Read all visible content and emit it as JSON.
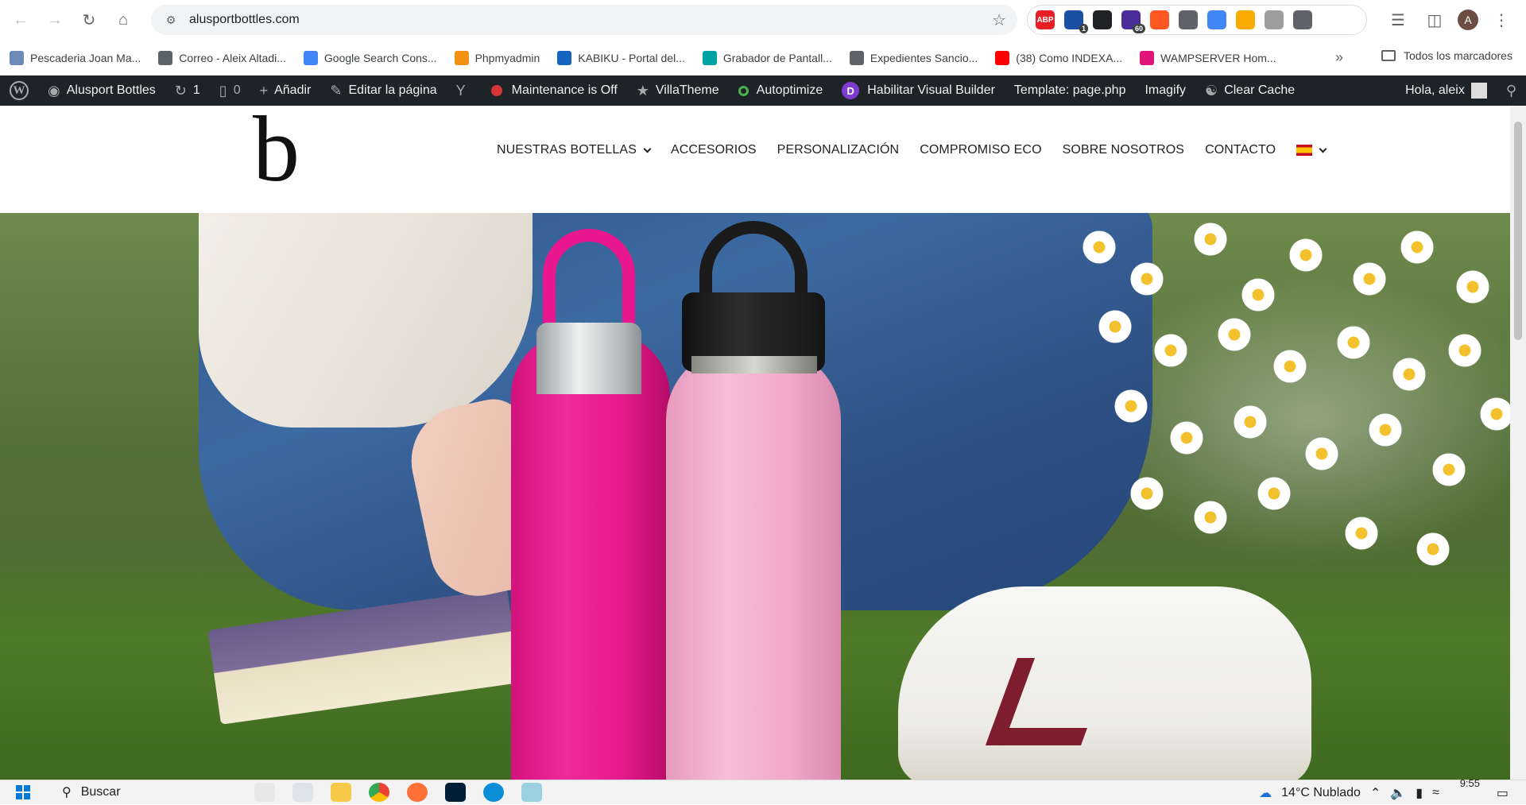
{
  "browser": {
    "url": "alusportbottles.com",
    "extensions": [
      {
        "name": "adblock-extension",
        "label": "ABP",
        "color": "#e81e25"
      },
      {
        "name": "mail-extension",
        "label": "",
        "badge": "1",
        "color": "#1a4fa3"
      },
      {
        "name": "color-picker-extension",
        "label": "",
        "color": "#202124"
      },
      {
        "name": "seo-extension",
        "label": "",
        "badge": "60",
        "color": "#4c2b9a"
      },
      {
        "name": "recorder-extension",
        "label": "",
        "color": "#ff5722"
      },
      {
        "name": "image-extension",
        "label": "",
        "color": "#5f6368"
      },
      {
        "name": "translate-extension",
        "label": "",
        "color": "#4285f4"
      },
      {
        "name": "analytics-extension",
        "label": "",
        "color": "#f9ab00"
      },
      {
        "name": "settings-extension",
        "label": "",
        "color": "#9e9e9e"
      },
      {
        "name": "puzzle-extension",
        "label": "",
        "color": "#5f6368"
      }
    ],
    "profile_initial": "A"
  },
  "bookmarks": {
    "items": [
      {
        "label": "Pescaderia Joan Ma...",
        "color": "#6b8ab5"
      },
      {
        "label": "Correo - Aleix Altadi...",
        "color": "#5f6368"
      },
      {
        "label": "Google Search Cons...",
        "color": "#4285f4"
      },
      {
        "label": "Phpmyadmin",
        "color": "#f29111"
      },
      {
        "label": "KABIKU - Portal del...",
        "color": "#1565c0"
      },
      {
        "label": "Grabador de Pantall...",
        "color": "#00a3a3"
      },
      {
        "label": "Expedientes Sancio...",
        "color": "#5f6368"
      },
      {
        "label": "(38) Como INDEXA...",
        "color": "#ff0000"
      },
      {
        "label": "WAMPSERVER Hom...",
        "color": "#e0157a"
      }
    ],
    "more": "»",
    "all_bookmarks": "Todos los marcadores"
  },
  "adminbar": {
    "site_name": "Alusport Bottles",
    "updates_count": "1",
    "comments_count": "0",
    "add_new": "Añadir",
    "edit_page": "Editar la página",
    "maintenance": "Maintenance is Off",
    "villatheme": "VillaTheme",
    "autoptimize": "Autoptimize",
    "visual_builder": "Habilitar Visual Builder",
    "template": "Template: page.php",
    "imagify": "Imagify",
    "clear_cache": "Clear Cache",
    "greeting": "Hola, aleix"
  },
  "site": {
    "logo": "b",
    "nav": [
      {
        "label": "NUESTRAS BOTELLAS",
        "has_dropdown": true
      },
      {
        "label": "ACCESORIOS"
      },
      {
        "label": "PERSONALIZACIÓN"
      },
      {
        "label": "COMPROMISO ECO"
      },
      {
        "label": "SOBRE NOSOTROS"
      },
      {
        "label": "CONTACTO"
      }
    ],
    "language_flag": "es"
  },
  "taskbar": {
    "search_placeholder": "Buscar",
    "weather": "14°C  Nublado",
    "time": "9:55"
  }
}
